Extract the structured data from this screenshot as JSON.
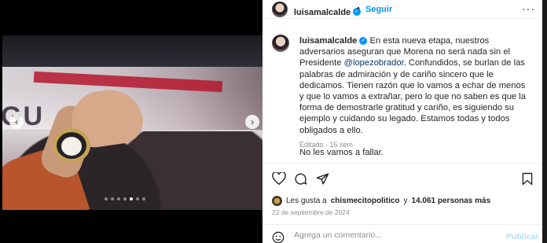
{
  "post": {
    "username": "luisamalcalde",
    "follow_label": "Seguir",
    "separator": "•",
    "more_label": "···",
    "caption_user": "luisamalcalde",
    "caption_part1": "En esta nueva etapa, nuestros adversarios aseguran que Morena no será nada sin el Presidente",
    "mention": "@lopezobrador",
    "caption_part2": ". Confundidos, se burlan de las palabras de admiración y de cariño sincero que le dedicamos. Tienen razón que lo vamos a echar de menos y que lo vamos a extrañar, pero lo que no saben es que la forma de demostrarle gratitud y cariño, es siguiendo su ejemplo y cuidando su legado. Estamos todas y todos obligados a ello.",
    "caption_closing": "No les vamos a fallar.",
    "edited": "Editado · 15 sem",
    "likes_prefix": "Les gusta a",
    "likes_user": "chismecitopolitico",
    "likes_conj": "y",
    "likes_count": "14.061 personas más",
    "date": "22 de septiembre de 2024",
    "comment_placeholder": "Agrega un comentario...",
    "publish_label": "Publicar",
    "nav_prev": "‹",
    "nav_next": "›"
  },
  "carousel": {
    "slides": 7,
    "active_index": 4
  },
  "icons": [
    "gear-icon",
    "heart-icon",
    "comment-icon",
    "share-icon",
    "save-icon",
    "emoji-icon",
    "verified-icon"
  ],
  "colors": {
    "accent": "#0095f6",
    "text": "#262626",
    "muted": "#8e8e8e",
    "mention": "#00376b"
  }
}
